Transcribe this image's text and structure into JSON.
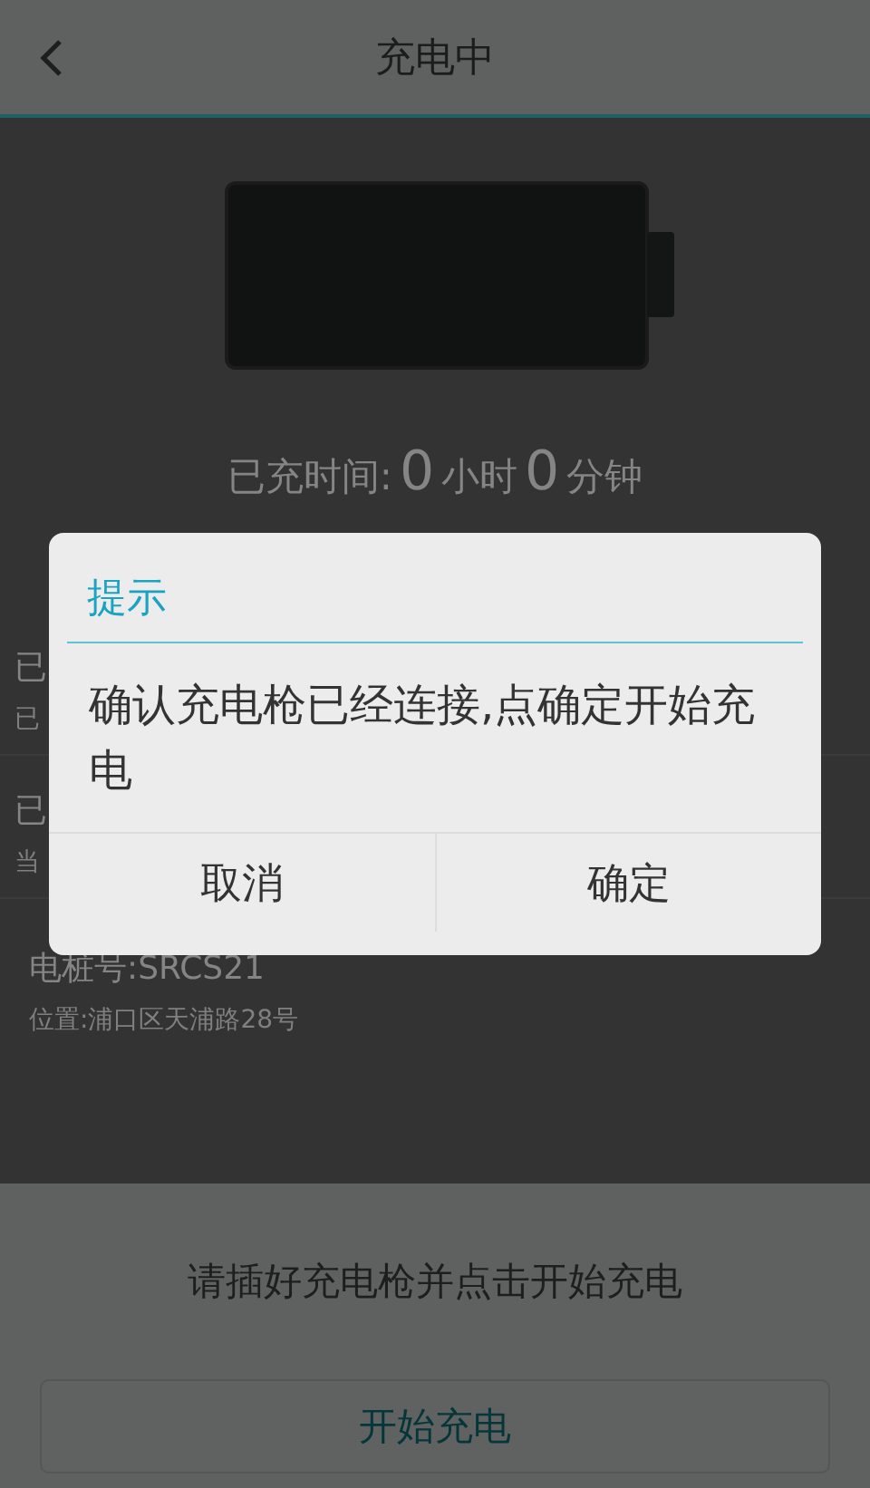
{
  "header": {
    "title": "充电中"
  },
  "charge_time": {
    "label": "已充时间:",
    "hours": "0",
    "hours_unit": "小时",
    "minutes": "0",
    "minutes_unit": "分钟"
  },
  "info_rows": [
    {
      "title": "已",
      "subtitle": "已"
    },
    {
      "title": "已",
      "subtitle": "当"
    },
    {
      "title": "电桩号:SRCS21",
      "subtitle": "位置:浦口区天浦路28号"
    }
  ],
  "footer": {
    "hint": "请插好充电枪并点击开始充电",
    "button": "开始充电"
  },
  "dialog": {
    "title": "提示",
    "message": "确认充电枪已经连接,点确定开始充电",
    "buttons": [
      "取消",
      "确定"
    ]
  }
}
